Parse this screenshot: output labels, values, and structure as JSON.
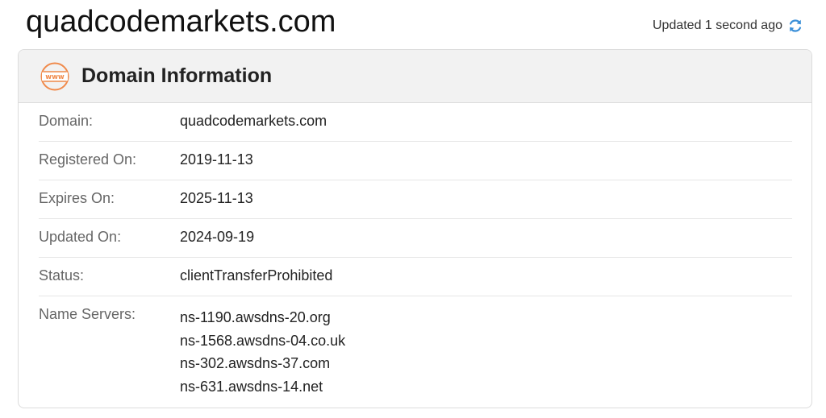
{
  "header": {
    "domain": "quadcodemarkets.com",
    "updated_text": "Updated 1 second ago"
  },
  "card": {
    "title": "Domain Information",
    "icon": "www-icon"
  },
  "rows": {
    "domain": {
      "label": "Domain:",
      "value": "quadcodemarkets.com"
    },
    "registered": {
      "label": "Registered On:",
      "value": "2019-11-13"
    },
    "expires": {
      "label": "Expires On:",
      "value": "2025-11-13"
    },
    "updated": {
      "label": "Updated On:",
      "value": "2024-09-19"
    },
    "status": {
      "label": "Status:",
      "value": "clientTransferProhibited"
    },
    "name_servers": {
      "label": "Name Servers:",
      "values": [
        "ns-1190.awsdns-20.org",
        "ns-1568.awsdns-04.co.uk",
        "ns-302.awsdns-37.com",
        "ns-631.awsdns-14.net"
      ]
    }
  },
  "colors": {
    "accent_icon": "#f08a4b",
    "refresh_icon": "#3a8fd8",
    "header_bg": "#f2f2f2"
  }
}
